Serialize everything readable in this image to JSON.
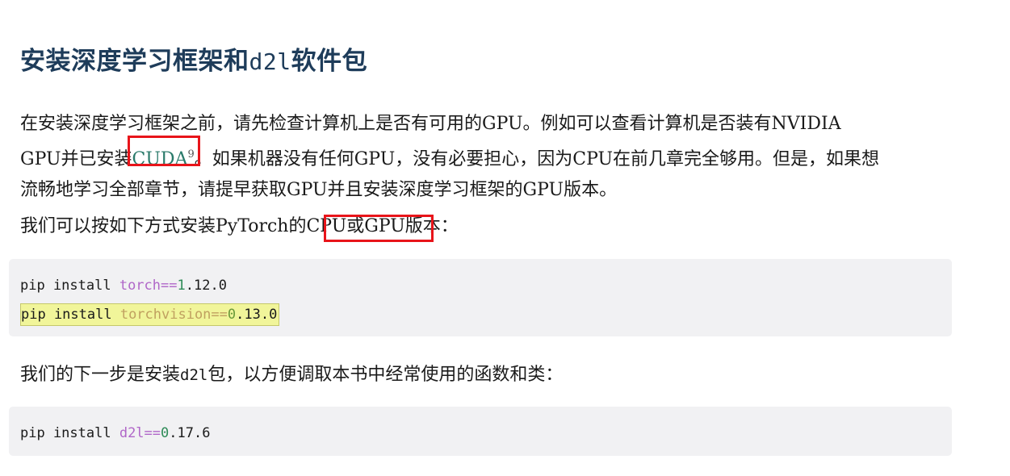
{
  "heading": {
    "text_pre": "安装深度学习框架和",
    "text_mono": "d2l",
    "text_post": "软件包"
  },
  "para1": {
    "line_a": "在安装深度学习框架之前，请先检查计算机上是否有可用的GPU。例如可以查看计算机是否装有NVIDIA",
    "line_b_pre": "GPU并已安装",
    "link_text": "CUDA",
    "footnote": "9",
    "line_b_post": "。如果机器没有任何GPU，没有必要担心，因为CPU在前几章完全够用。但是，如果想",
    "line_c": "流畅地学习全部章节，请提早获取GPU并且安装深度学习框架的GPU版本。"
  },
  "para2": {
    "pre": "我们可以按如下方式安装PyTorch的",
    "boxed": "CPU或GPU",
    "post": "版本："
  },
  "code1": {
    "line1": {
      "cmd": "pip install ",
      "pkg": "torch",
      "op": "==",
      "ver_major": "1",
      "ver_rest": ".12.0"
    },
    "line2": {
      "cmd": "pip install ",
      "pkg": "torchvision",
      "op": "==",
      "ver_major": "0",
      "ver_rest": ".13.0"
    }
  },
  "para3": {
    "pre": "我们的下一步是安装",
    "mono": "d2l",
    "post": "包，以方便调取本书中经常使用的函数和类："
  },
  "code2": {
    "line1": {
      "cmd": "pip install ",
      "pkg": "d2l",
      "op": "==",
      "ver_major": "0",
      "ver_rest": ".17.6"
    }
  },
  "colors": {
    "heading": "#1e3c5a",
    "link": "#2a7a6a",
    "highlight_box": "#e8141a",
    "code_bg": "#f1f1f3",
    "line_highlight": "#f1f59a"
  }
}
